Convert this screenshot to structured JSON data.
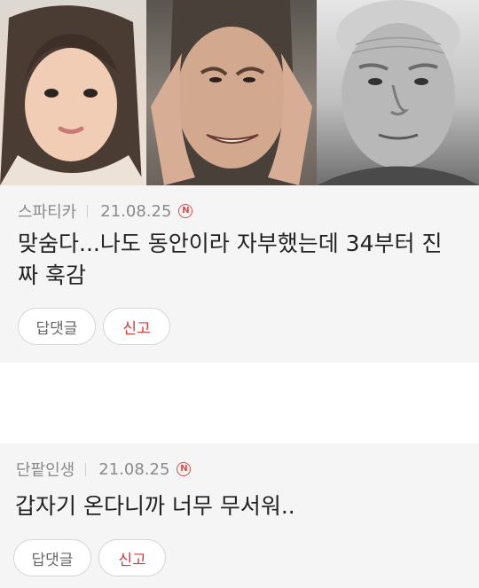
{
  "images": [
    {
      "name": "girl-photo"
    },
    {
      "name": "woman-photo"
    },
    {
      "name": "old-man-photo"
    }
  ],
  "comments": [
    {
      "author": "스파티카",
      "date": "21.08.25",
      "badge": "N",
      "text": "맞숨다...나도 동안이라 자부했는데 34부터 진짜 훅감",
      "reply_label": "답댓글",
      "report_label": "신고"
    },
    {
      "author": "단팥인생",
      "date": "21.08.25",
      "badge": "N",
      "text": "갑자기 온다니까 너무 무서워..",
      "reply_label": "답댓글",
      "report_label": "신고"
    }
  ],
  "colors": {
    "card_bg": "#f5f5f6",
    "report_red": "#d83a3a",
    "badge_red": "#e04a4a"
  }
}
